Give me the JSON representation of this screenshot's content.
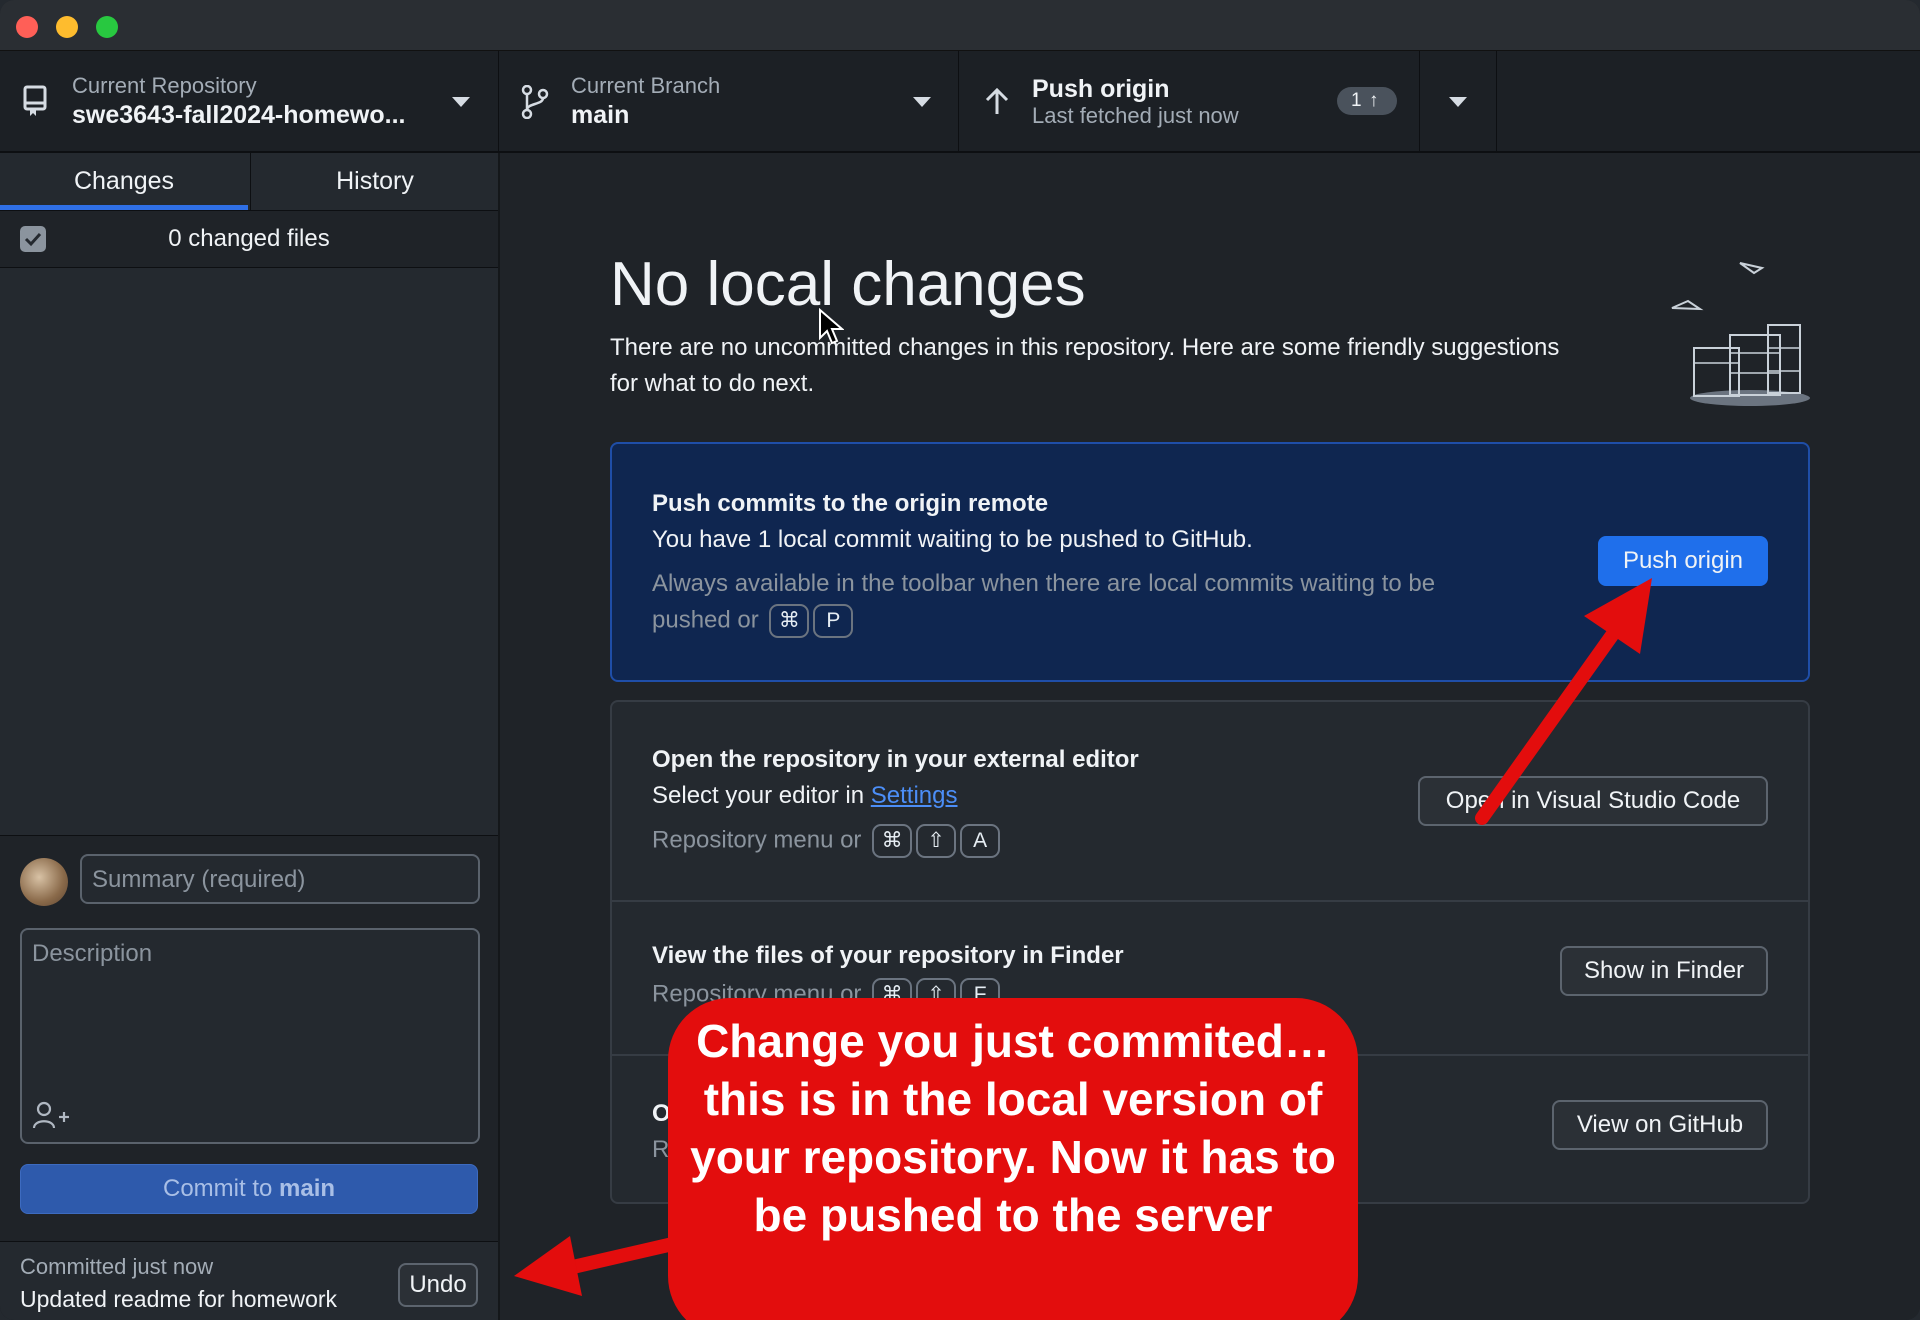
{
  "window": {
    "traffic_lights": {
      "close": "#ff5f57",
      "minimize": "#febc2e",
      "zoom": "#28c840"
    }
  },
  "toolbar": {
    "repo_label": "Current Repository",
    "repo_name": "swe3643-fall2024-homewo...",
    "branch_label": "Current Branch",
    "branch_name": "main",
    "push_title": "Push origin",
    "push_subtitle": "Last fetched just now",
    "push_count": "1",
    "icons": [
      "repo-icon",
      "branch-icon",
      "arrow-up-icon",
      "chevron-down-icon"
    ]
  },
  "sidebar": {
    "tabs": [
      {
        "label": "Changes",
        "active": true
      },
      {
        "label": "History",
        "active": false
      }
    ],
    "changed_files": "0 changed files",
    "summary_placeholder": "Summary (required)",
    "description_placeholder": "Description",
    "commit_prefix": "Commit to ",
    "commit_branch": "main",
    "last_commit_time": "Committed just now",
    "last_commit_message": "Updated readme for homework",
    "undo_label": "Undo"
  },
  "main": {
    "title": "No local changes",
    "description_line1": "There are no uncommitted changes in this repository. Here are some friendly suggestions",
    "description_line2": "for what to do next.",
    "cards": {
      "push": {
        "title": "Push commits to the origin remote",
        "text": "You have 1 local commit waiting to be pushed to GitHub.",
        "hint_line1": "Always available in the toolbar when there are local commits waiting to be",
        "hint_line2": "pushed or",
        "keys": [
          "⌘",
          "P"
        ],
        "button": "Push origin"
      },
      "editor": {
        "title": "Open the repository in your external editor",
        "text_prefix": "Select your editor in ",
        "link": "Settings",
        "hint": "Repository menu or",
        "keys": [
          "⌘",
          "⇧",
          "A"
        ],
        "button": "Open in Visual Studio Code"
      },
      "finder": {
        "title": "View the files of your repository in Finder",
        "hint": "Repository menu or",
        "keys": [
          "⌘",
          "⇧",
          "F"
        ],
        "button": "Show in Finder"
      },
      "github": {
        "title_fragment": "O",
        "hint_fragment": "R",
        "button": "View on GitHub"
      }
    }
  },
  "annotation": {
    "text": "Change you just commited… this is in the local version of your repository. Now it has to be pushed to the server",
    "color": "#e30d0d"
  },
  "colors": {
    "accent": "#2f6fe6",
    "push_card_bg": "#0f2650",
    "primary_button": "#1f6feb"
  }
}
